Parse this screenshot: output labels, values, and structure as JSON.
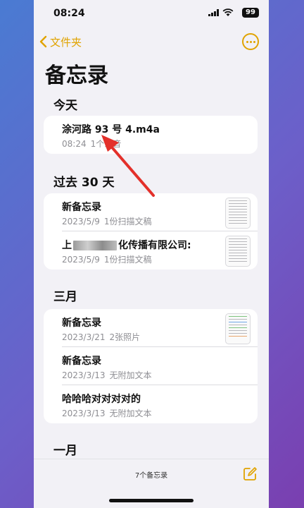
{
  "status": {
    "time": "08:24",
    "battery": "99"
  },
  "nav": {
    "back_label": "文件夹"
  },
  "page": {
    "title": "备忘录"
  },
  "sections": [
    {
      "label": "今天",
      "notes": [
        {
          "title": "涂河路 93 号 4.m4a",
          "date": "08:24",
          "info": "1个录音"
        }
      ]
    },
    {
      "label": "过去 30 天",
      "notes": [
        {
          "title": "新备忘录",
          "date": "2023/5/9",
          "info": "1份扫描文稿"
        },
        {
          "title_prefix": "上",
          "title_suffix": "化传播有限公司:",
          "date": "2023/5/9",
          "info": "1份扫描文稿"
        }
      ]
    },
    {
      "label": "三月",
      "notes": [
        {
          "title": "新备忘录",
          "date": "2023/3/21",
          "info": "2张照片"
        },
        {
          "title": "新备忘录",
          "date": "2023/3/13",
          "info": "无附加文本"
        },
        {
          "title": "哈哈哈对对对对的",
          "date": "2023/3/13",
          "info": "无附加文本"
        }
      ]
    },
    {
      "label": "一月"
    }
  ],
  "toolbar": {
    "count_label": "7个备忘录"
  },
  "colors": {
    "accent": "#e0a300",
    "annotation_arrow": "#e3302a"
  }
}
